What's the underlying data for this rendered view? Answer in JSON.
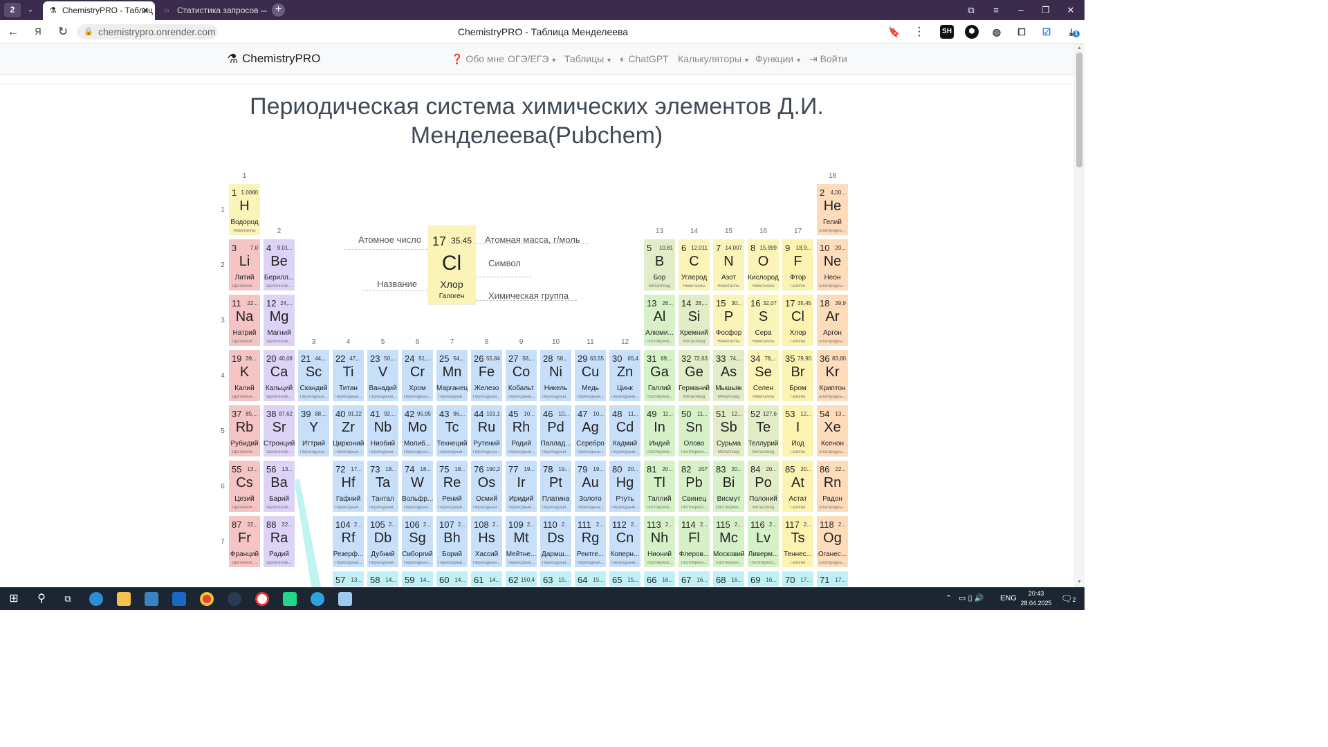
{
  "browser": {
    "tab_count": "2",
    "tabs": [
      {
        "label": "ChemistryPRO - Таблиц"
      },
      {
        "label": "Статистика запросов — I"
      }
    ],
    "url": "chemistrypro.onrender.com",
    "page_title": "ChemistryPRO - Таблица Менделеева",
    "toolbar_badge": "1"
  },
  "navbar": {
    "brand": "ChemistryPRO",
    "items": [
      "Обо мне",
      "ОГЭ/ЕГЭ",
      "Таблицы",
      "ChatGPT",
      "Калькуляторы",
      "Функции",
      "Войти"
    ]
  },
  "heading": {
    "line1": "Периодическая система химических элементов Д.И.",
    "line2": "Менделеева(Pubchem)"
  },
  "groups": [
    "1",
    "2",
    "3",
    "4",
    "5",
    "6",
    "7",
    "8",
    "9",
    "10",
    "11",
    "12",
    "13",
    "14",
    "15",
    "16",
    "17",
    "18"
  ],
  "periods": [
    "1",
    "2",
    "3",
    "4",
    "5",
    "6",
    "7"
  ],
  "legend": {
    "number": "17",
    "mass": "35.45",
    "symbol": "Cl",
    "name": "Хлор",
    "category": "Галоген",
    "label_number": "Атомное число",
    "label_mass": "Атомная масса, г/моль",
    "label_symbol": "Символ",
    "label_name": "Название",
    "label_group": "Химическая группа"
  },
  "elements": [
    {
      "n": "1",
      "m": "1.0080",
      "s": "H",
      "r": "Водород",
      "c": "Неметаллы",
      "cls": "nm",
      "g": 1,
      "p": 1
    },
    {
      "n": "2",
      "m": "4,00...",
      "s": "He",
      "r": "Гелий",
      "c": "Благородны...",
      "cls": "ng",
      "g": 18,
      "p": 1
    },
    {
      "n": "3",
      "m": "7,0",
      "s": "Li",
      "r": "Литий",
      "c": "Щелочной ...",
      "cls": "alk",
      "g": 1,
      "p": 2
    },
    {
      "n": "4",
      "m": "9,01...",
      "s": "Be",
      "r": "Берилл...",
      "c": "Щелочнозе...",
      "cls": "ae",
      "g": 2,
      "p": 2
    },
    {
      "n": "5",
      "m": "10,81",
      "s": "B",
      "r": "Бор",
      "c": "Металлоид",
      "cls": "md",
      "g": 13,
      "p": 2
    },
    {
      "n": "6",
      "m": "12,011",
      "s": "C",
      "r": "Углерод",
      "c": "Неметаллы",
      "cls": "nm",
      "g": 14,
      "p": 2
    },
    {
      "n": "7",
      "m": "14,007",
      "s": "N",
      "r": "Азот",
      "c": "Неметаллы",
      "cls": "nm",
      "g": 15,
      "p": 2
    },
    {
      "n": "8",
      "m": "15,999",
      "s": "O",
      "r": "Кислород",
      "c": "Неметаллы",
      "cls": "nm",
      "g": 16,
      "p": 2
    },
    {
      "n": "9",
      "m": "18,9...",
      "s": "F",
      "r": "Фтор",
      "c": "Галоген",
      "cls": "hal",
      "g": 17,
      "p": 2
    },
    {
      "n": "10",
      "m": "20...",
      "s": "Ne",
      "r": "Неон",
      "c": "Благородны...",
      "cls": "ng",
      "g": 18,
      "p": 2
    },
    {
      "n": "11",
      "m": "22...",
      "s": "Na",
      "r": "Натрий",
      "c": "Щелочной ...",
      "cls": "alk",
      "g": 1,
      "p": 3
    },
    {
      "n": "12",
      "m": "24,...",
      "s": "Mg",
      "r": "Магний",
      "c": "Щелочнозе...",
      "cls": "ae",
      "g": 2,
      "p": 3
    },
    {
      "n": "13",
      "m": "26...",
      "s": "Al",
      "r": "Алюми...",
      "c": "Постпереxo...",
      "cls": "pt",
      "g": 13,
      "p": 3
    },
    {
      "n": "14",
      "m": "28,...",
      "s": "Si",
      "r": "Кремний",
      "c": "Металлоид",
      "cls": "md",
      "g": 14,
      "p": 3
    },
    {
      "n": "15",
      "m": "30...",
      "s": "P",
      "r": "Фосфор",
      "c": "Неметаллы",
      "cls": "nm",
      "g": 15,
      "p": 3
    },
    {
      "n": "16",
      "m": "32,07",
      "s": "S",
      "r": "Сера",
      "c": "Неметаллы",
      "cls": "nm",
      "g": 16,
      "p": 3
    },
    {
      "n": "17",
      "m": "35,45",
      "s": "Cl",
      "r": "Хлор",
      "c": "Галоген",
      "cls": "hal",
      "g": 17,
      "p": 3
    },
    {
      "n": "18",
      "m": "39,9",
      "s": "Ar",
      "r": "Аргон",
      "c": "Благородны...",
      "cls": "ng",
      "g": 18,
      "p": 3
    },
    {
      "n": "19",
      "m": "39,...",
      "s": "K",
      "r": "Калий",
      "c": "Щелочной ...",
      "cls": "alk",
      "g": 1,
      "p": 4
    },
    {
      "n": "20",
      "m": "40,08",
      "s": "Ca",
      "r": "Кальций",
      "c": "Щелочнозе...",
      "cls": "ae",
      "g": 2,
      "p": 4
    },
    {
      "n": "21",
      "m": "44,...",
      "s": "Sc",
      "r": "Скандий",
      "c": "Переходный...",
      "cls": "tm",
      "g": 3,
      "p": 4
    },
    {
      "n": "22",
      "m": "47,...",
      "s": "Ti",
      "r": "Титан",
      "c": "Переходный...",
      "cls": "tm",
      "g": 4,
      "p": 4
    },
    {
      "n": "23",
      "m": "50,...",
      "s": "V",
      "r": "Ванадий",
      "c": "Переходный...",
      "cls": "tm",
      "g": 5,
      "p": 4
    },
    {
      "n": "24",
      "m": "51,...",
      "s": "Cr",
      "r": "Хром",
      "c": "Переходный...",
      "cls": "tm",
      "g": 6,
      "p": 4
    },
    {
      "n": "25",
      "m": "54,...",
      "s": "Mn",
      "r": "Марганец",
      "c": "Переходный...",
      "cls": "tm",
      "g": 7,
      "p": 4
    },
    {
      "n": "26",
      "m": "55,84",
      "s": "Fe",
      "r": "Железо",
      "c": "Переходный...",
      "cls": "tm",
      "g": 8,
      "p": 4
    },
    {
      "n": "27",
      "m": "58,...",
      "s": "Co",
      "r": "Кобальт",
      "c": "Переходный...",
      "cls": "tm",
      "g": 9,
      "p": 4
    },
    {
      "n": "28",
      "m": "58,...",
      "s": "Ni",
      "r": "Никель",
      "c": "Переходный...",
      "cls": "tm",
      "g": 10,
      "p": 4
    },
    {
      "n": "29",
      "m": "63,55",
      "s": "Cu",
      "r": "Медь",
      "c": "Переходный...",
      "cls": "tm",
      "g": 11,
      "p": 4
    },
    {
      "n": "30",
      "m": "65,4",
      "s": "Zn",
      "r": "Цинк",
      "c": "Переходный...",
      "cls": "tm",
      "g": 12,
      "p": 4
    },
    {
      "n": "31",
      "m": "69,...",
      "s": "Ga",
      "r": "Галлий",
      "c": "Постпереxo...",
      "cls": "pt",
      "g": 13,
      "p": 4
    },
    {
      "n": "32",
      "m": "72,63",
      "s": "Ge",
      "r": "Германий",
      "c": "Металлоид",
      "cls": "md",
      "g": 14,
      "p": 4
    },
    {
      "n": "33",
      "m": "74,...",
      "s": "As",
      "r": "Мышьяк",
      "c": "Металлоид",
      "cls": "md",
      "g": 15,
      "p": 4
    },
    {
      "n": "34",
      "m": "78,...",
      "s": "Se",
      "r": "Селен",
      "c": "Неметаллы",
      "cls": "nm",
      "g": 16,
      "p": 4
    },
    {
      "n": "35",
      "m": "79,90",
      "s": "Br",
      "r": "Бром",
      "c": "Галоген",
      "cls": "hal",
      "g": 17,
      "p": 4
    },
    {
      "n": "36",
      "m": "83,80",
      "s": "Kr",
      "r": "Криптон",
      "c": "Благородны...",
      "cls": "ng",
      "g": 18,
      "p": 4
    },
    {
      "n": "37",
      "m": "85,...",
      "s": "Rb",
      "r": "Рубидий",
      "c": "Щелочной ...",
      "cls": "alk",
      "g": 1,
      "p": 5
    },
    {
      "n": "38",
      "m": "87,62",
      "s": "Sr",
      "r": "Стронций",
      "c": "Щелочнозе...",
      "cls": "ae",
      "g": 2,
      "p": 5
    },
    {
      "n": "39",
      "m": "88,...",
      "s": "Y",
      "r": "Иттрий",
      "c": "Переходный...",
      "cls": "tm",
      "g": 3,
      "p": 5
    },
    {
      "n": "40",
      "m": "91,22",
      "s": "Zr",
      "r": "Цирконий",
      "c": "Переходный...",
      "cls": "tm",
      "g": 4,
      "p": 5
    },
    {
      "n": "41",
      "m": "92,...",
      "s": "Nb",
      "r": "Ниобий",
      "c": "Переходный...",
      "cls": "tm",
      "g": 5,
      "p": 5
    },
    {
      "n": "42",
      "m": "95,95",
      "s": "Mo",
      "r": "Молиб...",
      "c": "Переходный...",
      "cls": "tm",
      "g": 6,
      "p": 5
    },
    {
      "n": "43",
      "m": "96,...",
      "s": "Tc",
      "r": "Технеций",
      "c": "Переходный...",
      "cls": "tm",
      "g": 7,
      "p": 5
    },
    {
      "n": "44",
      "m": "101,1",
      "s": "Ru",
      "r": "Рутений",
      "c": "Переходный...",
      "cls": "tm",
      "g": 8,
      "p": 5
    },
    {
      "n": "45",
      "m": "10...",
      "s": "Rh",
      "r": "Родий",
      "c": "Переходный...",
      "cls": "tm",
      "g": 9,
      "p": 5
    },
    {
      "n": "46",
      "m": "10...",
      "s": "Pd",
      "r": "Паллад...",
      "c": "Переходный...",
      "cls": "tm",
      "g": 10,
      "p": 5
    },
    {
      "n": "47",
      "m": "10...",
      "s": "Ag",
      "r": "Серебро",
      "c": "Переходный...",
      "cls": "tm",
      "g": 11,
      "p": 5
    },
    {
      "n": "48",
      "m": "11...",
      "s": "Cd",
      "r": "Кадмий",
      "c": "Переходный...",
      "cls": "tm",
      "g": 12,
      "p": 5
    },
    {
      "n": "49",
      "m": "11...",
      "s": "In",
      "r": "Индий",
      "c": "Постпереxo...",
      "cls": "pt",
      "g": 13,
      "p": 5
    },
    {
      "n": "50",
      "m": "11...",
      "s": "Sn",
      "r": "Олово",
      "c": "Постпереxo...",
      "cls": "pt",
      "g": 14,
      "p": 5
    },
    {
      "n": "51",
      "m": "12...",
      "s": "Sb",
      "r": "Сурьма",
      "c": "Металлоид",
      "cls": "md",
      "g": 15,
      "p": 5
    },
    {
      "n": "52",
      "m": "127,6",
      "s": "Te",
      "r": "Теллурий",
      "c": "Металлоид",
      "cls": "md",
      "g": 16,
      "p": 5
    },
    {
      "n": "53",
      "m": "12...",
      "s": "I",
      "r": "Йод",
      "c": "Галоген",
      "cls": "hal",
      "g": 17,
      "p": 5
    },
    {
      "n": "54",
      "m": "13...",
      "s": "Xe",
      "r": "Ксенон",
      "c": "Благородны...",
      "cls": "ng",
      "g": 18,
      "p": 5
    },
    {
      "n": "55",
      "m": "13...",
      "s": "Cs",
      "r": "Цезий",
      "c": "Щелочной ...",
      "cls": "alk",
      "g": 1,
      "p": 6
    },
    {
      "n": "56",
      "m": "13...",
      "s": "Ba",
      "r": "Барий",
      "c": "Щелочнозе...",
      "cls": "ae",
      "g": 2,
      "p": 6
    },
    {
      "n": "72",
      "m": "17...",
      "s": "Hf",
      "r": "Гафний",
      "c": "Переходный...",
      "cls": "tm",
      "g": 4,
      "p": 6
    },
    {
      "n": "73",
      "m": "18...",
      "s": "Ta",
      "r": "Тантал",
      "c": "Переходный...",
      "cls": "tm",
      "g": 5,
      "p": 6
    },
    {
      "n": "74",
      "m": "18...",
      "s": "W",
      "r": "Вольфр...",
      "c": "Переходный...",
      "cls": "tm",
      "g": 6,
      "p": 6
    },
    {
      "n": "75",
      "m": "18...",
      "s": "Re",
      "r": "Рений",
      "c": "Переходный...",
      "cls": "tm",
      "g": 7,
      "p": 6
    },
    {
      "n": "76",
      "m": "190,2",
      "s": "Os",
      "r": "Осмий",
      "c": "Переходный...",
      "cls": "tm",
      "g": 8,
      "p": 6
    },
    {
      "n": "77",
      "m": "19...",
      "s": "Ir",
      "r": "Иридий",
      "c": "Переходный...",
      "cls": "tm",
      "g": 9,
      "p": 6
    },
    {
      "n": "78",
      "m": "19...",
      "s": "Pt",
      "r": "Платина",
      "c": "Переходный...",
      "cls": "tm",
      "g": 10,
      "p": 6
    },
    {
      "n": "79",
      "m": "19...",
      "s": "Au",
      "r": "Золото",
      "c": "Переходный...",
      "cls": "tm",
      "g": 11,
      "p": 6
    },
    {
      "n": "80",
      "m": "20...",
      "s": "Hg",
      "r": "Ртуть",
      "c": "Переходный...",
      "cls": "tm",
      "g": 12,
      "p": 6
    },
    {
      "n": "81",
      "m": "20...",
      "s": "Tl",
      "r": "Таллий",
      "c": "Постпереxo...",
      "cls": "pt",
      "g": 13,
      "p": 6
    },
    {
      "n": "82",
      "m": "207",
      "s": "Pb",
      "r": "Свинец",
      "c": "Постпереxo...",
      "cls": "pt",
      "g": 14,
      "p": 6
    },
    {
      "n": "83",
      "m": "20...",
      "s": "Bi",
      "r": "Висмут",
      "c": "Постпереxo...",
      "cls": "pt",
      "g": 15,
      "p": 6
    },
    {
      "n": "84",
      "m": "20...",
      "s": "Po",
      "r": "Полоний",
      "c": "Металлоид",
      "cls": "md",
      "g": 16,
      "p": 6
    },
    {
      "n": "85",
      "m": "20...",
      "s": "At",
      "r": "Астат",
      "c": "Галоген",
      "cls": "hal",
      "g": 17,
      "p": 6
    },
    {
      "n": "86",
      "m": "22...",
      "s": "Rn",
      "r": "Радон",
      "c": "Благородны...",
      "cls": "ng",
      "g": 18,
      "p": 6
    },
    {
      "n": "87",
      "m": "22...",
      "s": "Fr",
      "r": "Франций",
      "c": "Щелочной ...",
      "cls": "alk",
      "g": 1,
      "p": 7
    },
    {
      "n": "88",
      "m": "22...",
      "s": "Ra",
      "r": "Радий",
      "c": "Щелочнозе...",
      "cls": "ae",
      "g": 2,
      "p": 7
    },
    {
      "n": "104",
      "m": "2...",
      "s": "Rf",
      "r": "Резерф...",
      "c": "Переходный...",
      "cls": "tm",
      "g": 4,
      "p": 7
    },
    {
      "n": "105",
      "m": "2...",
      "s": "Db",
      "r": "Дубний",
      "c": "Переходный...",
      "cls": "tm",
      "g": 5,
      "p": 7
    },
    {
      "n": "106",
      "m": "2...",
      "s": "Sg",
      "r": "Сиборгий",
      "c": "Переходный...",
      "cls": "tm",
      "g": 6,
      "p": 7
    },
    {
      "n": "107",
      "m": "2...",
      "s": "Bh",
      "r": "Борий",
      "c": "Переходный...",
      "cls": "tm",
      "g": 7,
      "p": 7
    },
    {
      "n": "108",
      "m": "2...",
      "s": "Hs",
      "r": "Хассий",
      "c": "Переходный...",
      "cls": "tm",
      "g": 8,
      "p": 7
    },
    {
      "n": "109",
      "m": "2...",
      "s": "Mt",
      "r": "Мейтне...",
      "c": "Переходный...",
      "cls": "tm",
      "g": 9,
      "p": 7
    },
    {
      "n": "110",
      "m": "2...",
      "s": "Ds",
      "r": "Дармш...",
      "c": "Переходный...",
      "cls": "tm",
      "g": 10,
      "p": 7
    },
    {
      "n": "111",
      "m": "2...",
      "s": "Rg",
      "r": "Рентге...",
      "c": "Переходный...",
      "cls": "tm",
      "g": 11,
      "p": 7
    },
    {
      "n": "112",
      "m": "2...",
      "s": "Cn",
      "r": "Коперн...",
      "c": "Переходный...",
      "cls": "tm",
      "g": 12,
      "p": 7
    },
    {
      "n": "113",
      "m": "2...",
      "s": "Nh",
      "r": "Нионий",
      "c": "Постпереxo...",
      "cls": "pt",
      "g": 13,
      "p": 7
    },
    {
      "n": "114",
      "m": "2...",
      "s": "Fl",
      "r": "Флеров...",
      "c": "Постпереxo...",
      "cls": "pt",
      "g": 14,
      "p": 7
    },
    {
      "n": "115",
      "m": "2...",
      "s": "Mc",
      "r": "Московий",
      "c": "Постпереxo...",
      "cls": "pt",
      "g": 15,
      "p": 7
    },
    {
      "n": "116",
      "m": "2...",
      "s": "Lv",
      "r": "Ливерм...",
      "c": "Постпереxo...",
      "cls": "pt",
      "g": 16,
      "p": 7
    },
    {
      "n": "117",
      "m": "2...",
      "s": "Ts",
      "r": "Теннес...",
      "c": "Галоген",
      "cls": "hal",
      "g": 17,
      "p": 7
    },
    {
      "n": "118",
      "m": "2...",
      "s": "Og",
      "r": "Оганес...",
      "c": "Благородны...",
      "cls": "ng",
      "g": 18,
      "p": 7
    },
    {
      "n": "57",
      "m": "13...",
      "s": "",
      "r": "",
      "c": "",
      "cls": "ln",
      "g": 4,
      "p": 8
    },
    {
      "n": "58",
      "m": "14...",
      "s": "",
      "r": "",
      "c": "",
      "cls": "ln",
      "g": 5,
      "p": 8
    },
    {
      "n": "59",
      "m": "14...",
      "s": "",
      "r": "",
      "c": "",
      "cls": "ln",
      "g": 6,
      "p": 8
    },
    {
      "n": "60",
      "m": "14...",
      "s": "",
      "r": "",
      "c": "",
      "cls": "ln",
      "g": 7,
      "p": 8
    },
    {
      "n": "61",
      "m": "14...",
      "s": "",
      "r": "",
      "c": "",
      "cls": "ln",
      "g": 8,
      "p": 8
    },
    {
      "n": "62",
      "m": "150,4",
      "s": "",
      "r": "",
      "c": "",
      "cls": "ln",
      "g": 9,
      "p": 8
    },
    {
      "n": "63",
      "m": "15...",
      "s": "",
      "r": "",
      "c": "",
      "cls": "ln",
      "g": 10,
      "p": 8
    },
    {
      "n": "64",
      "m": "15...",
      "s": "",
      "r": "",
      "c": "",
      "cls": "ln",
      "g": 11,
      "p": 8
    },
    {
      "n": "65",
      "m": "15...",
      "s": "",
      "r": "",
      "c": "",
      "cls": "ln",
      "g": 12,
      "p": 8
    },
    {
      "n": "66",
      "m": "16...",
      "s": "",
      "r": "",
      "c": "",
      "cls": "ln",
      "g": 13,
      "p": 8
    },
    {
      "n": "67",
      "m": "16...",
      "s": "",
      "r": "",
      "c": "",
      "cls": "ln",
      "g": 14,
      "p": 8
    },
    {
      "n": "68",
      "m": "16...",
      "s": "",
      "r": "",
      "c": "",
      "cls": "ln",
      "g": 15,
      "p": 8
    },
    {
      "n": "69",
      "m": "16...",
      "s": "",
      "r": "",
      "c": "",
      "cls": "ln",
      "g": 16,
      "p": 8
    },
    {
      "n": "70",
      "m": "17...",
      "s": "",
      "r": "",
      "c": "",
      "cls": "ln",
      "g": 17,
      "p": 8
    },
    {
      "n": "71",
      "m": "17...",
      "s": "",
      "r": "",
      "c": "",
      "cls": "ln",
      "g": 18,
      "p": 8
    }
  ],
  "taskbar": {
    "lang": "ENG",
    "time": "20:43",
    "date": "28.04.2025",
    "notif": "2"
  }
}
